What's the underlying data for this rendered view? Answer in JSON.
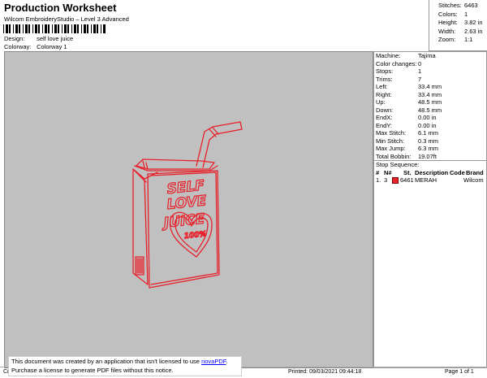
{
  "header": {
    "title": "Production Worksheet",
    "subtitle": "Wilcom EmbroideryStudio – Level 3 Advanced",
    "design_label": "Design:",
    "design_value": "self love juice",
    "colorway_label": "Colorway:",
    "colorway_value": "Colorway 1"
  },
  "stats": [
    {
      "label": "Stitches:",
      "value": "6463"
    },
    {
      "label": "Colors:",
      "value": "1"
    },
    {
      "label": "Height:",
      "value": "3.82 in"
    },
    {
      "label": "Width:",
      "value": "2.63 in"
    },
    {
      "label": "Zoom:",
      "value": "1:1"
    }
  ],
  "machine_info": [
    {
      "label": "Machine:",
      "value": "Tajima"
    },
    {
      "label": "Color changes:",
      "value": "0"
    },
    {
      "label": "Stops:",
      "value": "1"
    },
    {
      "label": "Trims:",
      "value": "7"
    },
    {
      "label": "Left:",
      "value": "33.4 mm"
    },
    {
      "label": "Right:",
      "value": "33.4 mm"
    },
    {
      "label": "Up:",
      "value": "48.5 mm"
    },
    {
      "label": "Down:",
      "value": "48.5 mm"
    },
    {
      "label": "EndX:",
      "value": "0.00 in"
    },
    {
      "label": "EndY:",
      "value": "0.00 in"
    },
    {
      "label": "Max Stitch:",
      "value": "6.1 mm"
    },
    {
      "label": "Min Stitch:",
      "value": "0.3 mm"
    },
    {
      "label": "Max Jump:",
      "value": "6.3 mm"
    },
    {
      "label": "Total Bobbin:",
      "value": "19.07ft"
    }
  ],
  "stop_sequence": {
    "title": "Stop Sequence:",
    "columns": [
      "#",
      "N#",
      "St.",
      "Description",
      "Code",
      "Brand"
    ],
    "rows": [
      {
        "index": "1.",
        "needle": "3",
        "color": "#e8202a",
        "stitches": "6461",
        "description": "MERAH",
        "code": "",
        "brand": "Wilcom"
      }
    ]
  },
  "design": {
    "text_line1": "SELF",
    "text_line2": "LOVE",
    "text_line3": "JUICE",
    "text_line4": "100%",
    "thread_color": "#e8202a"
  },
  "notice": {
    "line1_prefix": "This document was created by an application that isn't licensed to use ",
    "link": "novaPDF",
    "line1_suffix": ".",
    "line2": "Purchase a license to generate PDF files without this notice."
  },
  "footer": {
    "left": "Cr",
    "printed": "Printed: 09/03/2021 09:44:18",
    "page": "Page 1 of 1"
  }
}
